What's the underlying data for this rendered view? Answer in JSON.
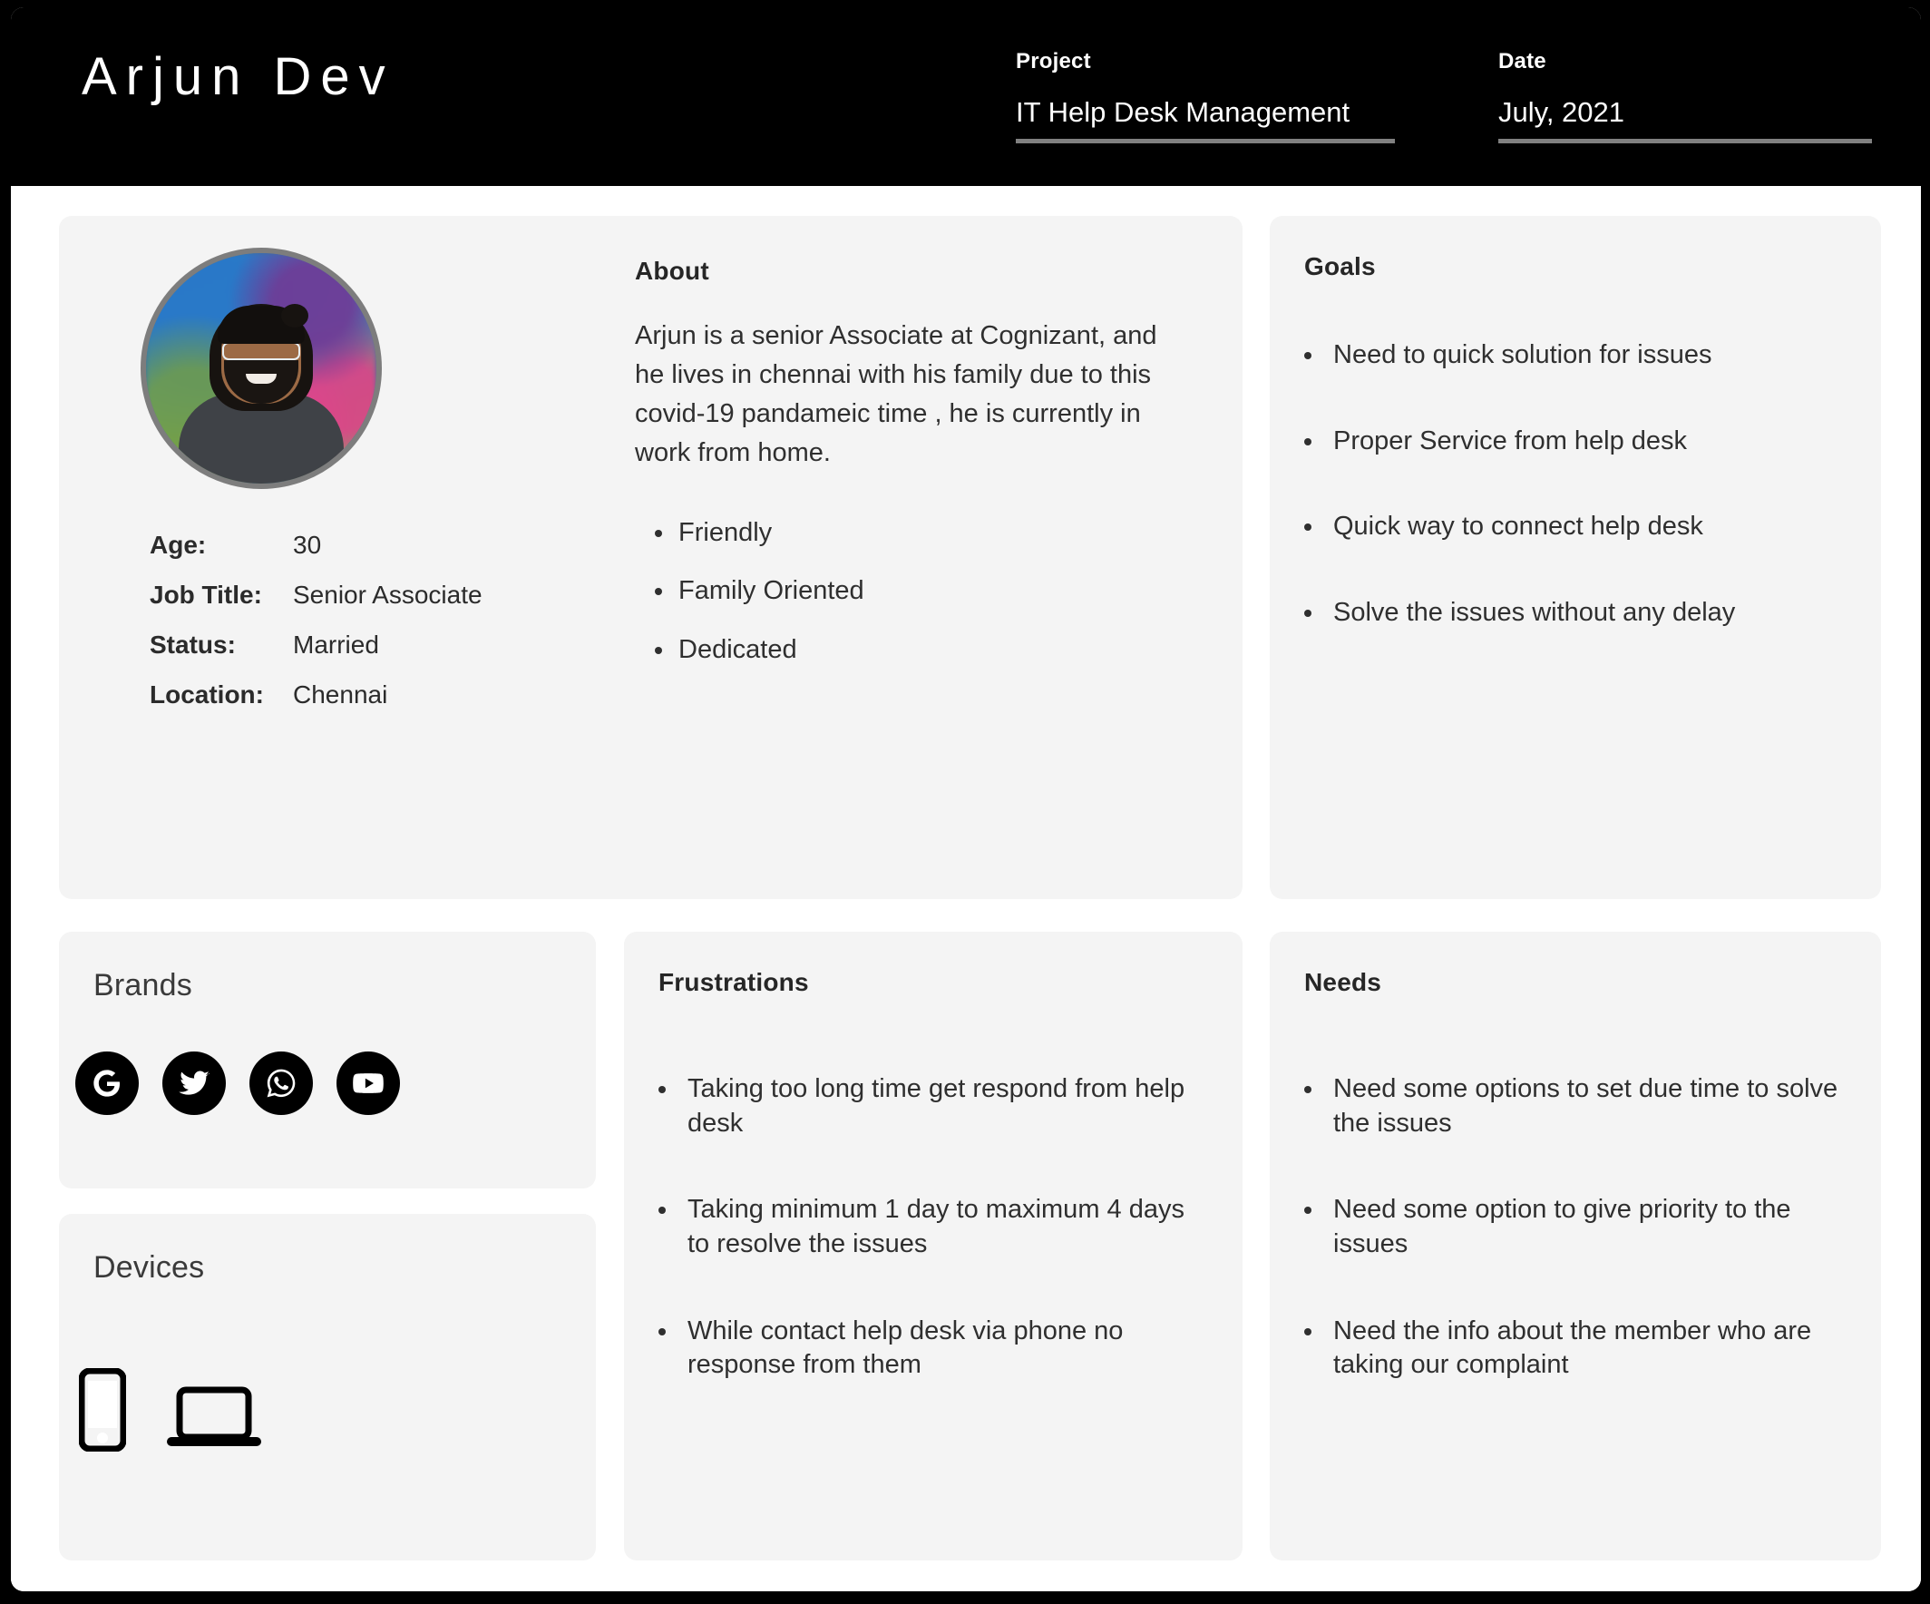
{
  "header": {
    "persona_name": "Arjun Dev",
    "project_label": "Project",
    "project_value": "IT Help Desk Management",
    "date_label": "Date",
    "date_value": "July, 2021"
  },
  "profile": {
    "facts": [
      {
        "label": "Age:",
        "value": "30"
      },
      {
        "label": "Job Title:",
        "value": "Senior Associate"
      },
      {
        "label": "Status:",
        "value": "Married"
      },
      {
        "label": "Location:",
        "value": "Chennai"
      }
    ]
  },
  "about": {
    "title": "About",
    "paragraph": "Arjun is a senior Associate at Cognizant, and he lives in chennai with his family due to this covid-19 pandameic time , he is currently in work from home.",
    "traits": [
      "Friendly",
      "Family Oriented",
      "Dedicated"
    ]
  },
  "goals": {
    "title": "Goals",
    "items": [
      "Need to quick solution for issues",
      "Proper Service from help desk",
      "Quick way to connect help desk",
      "Solve the issues without any delay"
    ]
  },
  "brands": {
    "title": "Brands",
    "items": [
      {
        "name": "google-icon",
        "label": "Google"
      },
      {
        "name": "twitter-icon",
        "label": "Twitter"
      },
      {
        "name": "whatsapp-icon",
        "label": "WhatsApp"
      },
      {
        "name": "youtube-icon",
        "label": "YouTube"
      }
    ]
  },
  "devices": {
    "title": "Devices",
    "items": [
      {
        "name": "smartphone-icon",
        "label": "Smartphone"
      },
      {
        "name": "laptop-icon",
        "label": "Laptop"
      }
    ]
  },
  "frustrations": {
    "title": "Frustrations",
    "items": [
      "Taking too long time get respond from help desk",
      "Taking minimum 1 day to maximum 4 days to resolve the issues",
      "While contact help desk via phone no response from them"
    ]
  },
  "needs": {
    "title": "Needs",
    "items": [
      "Need some options to set due time to solve the issues",
      "Need some option to give priority to the issues",
      "Need the info about the member who are taking our complaint"
    ]
  },
  "colors": {
    "header_bg": "#000000",
    "card_bg": "#f4f4f4",
    "text": "#2f2f2f",
    "rule": "#808080"
  }
}
